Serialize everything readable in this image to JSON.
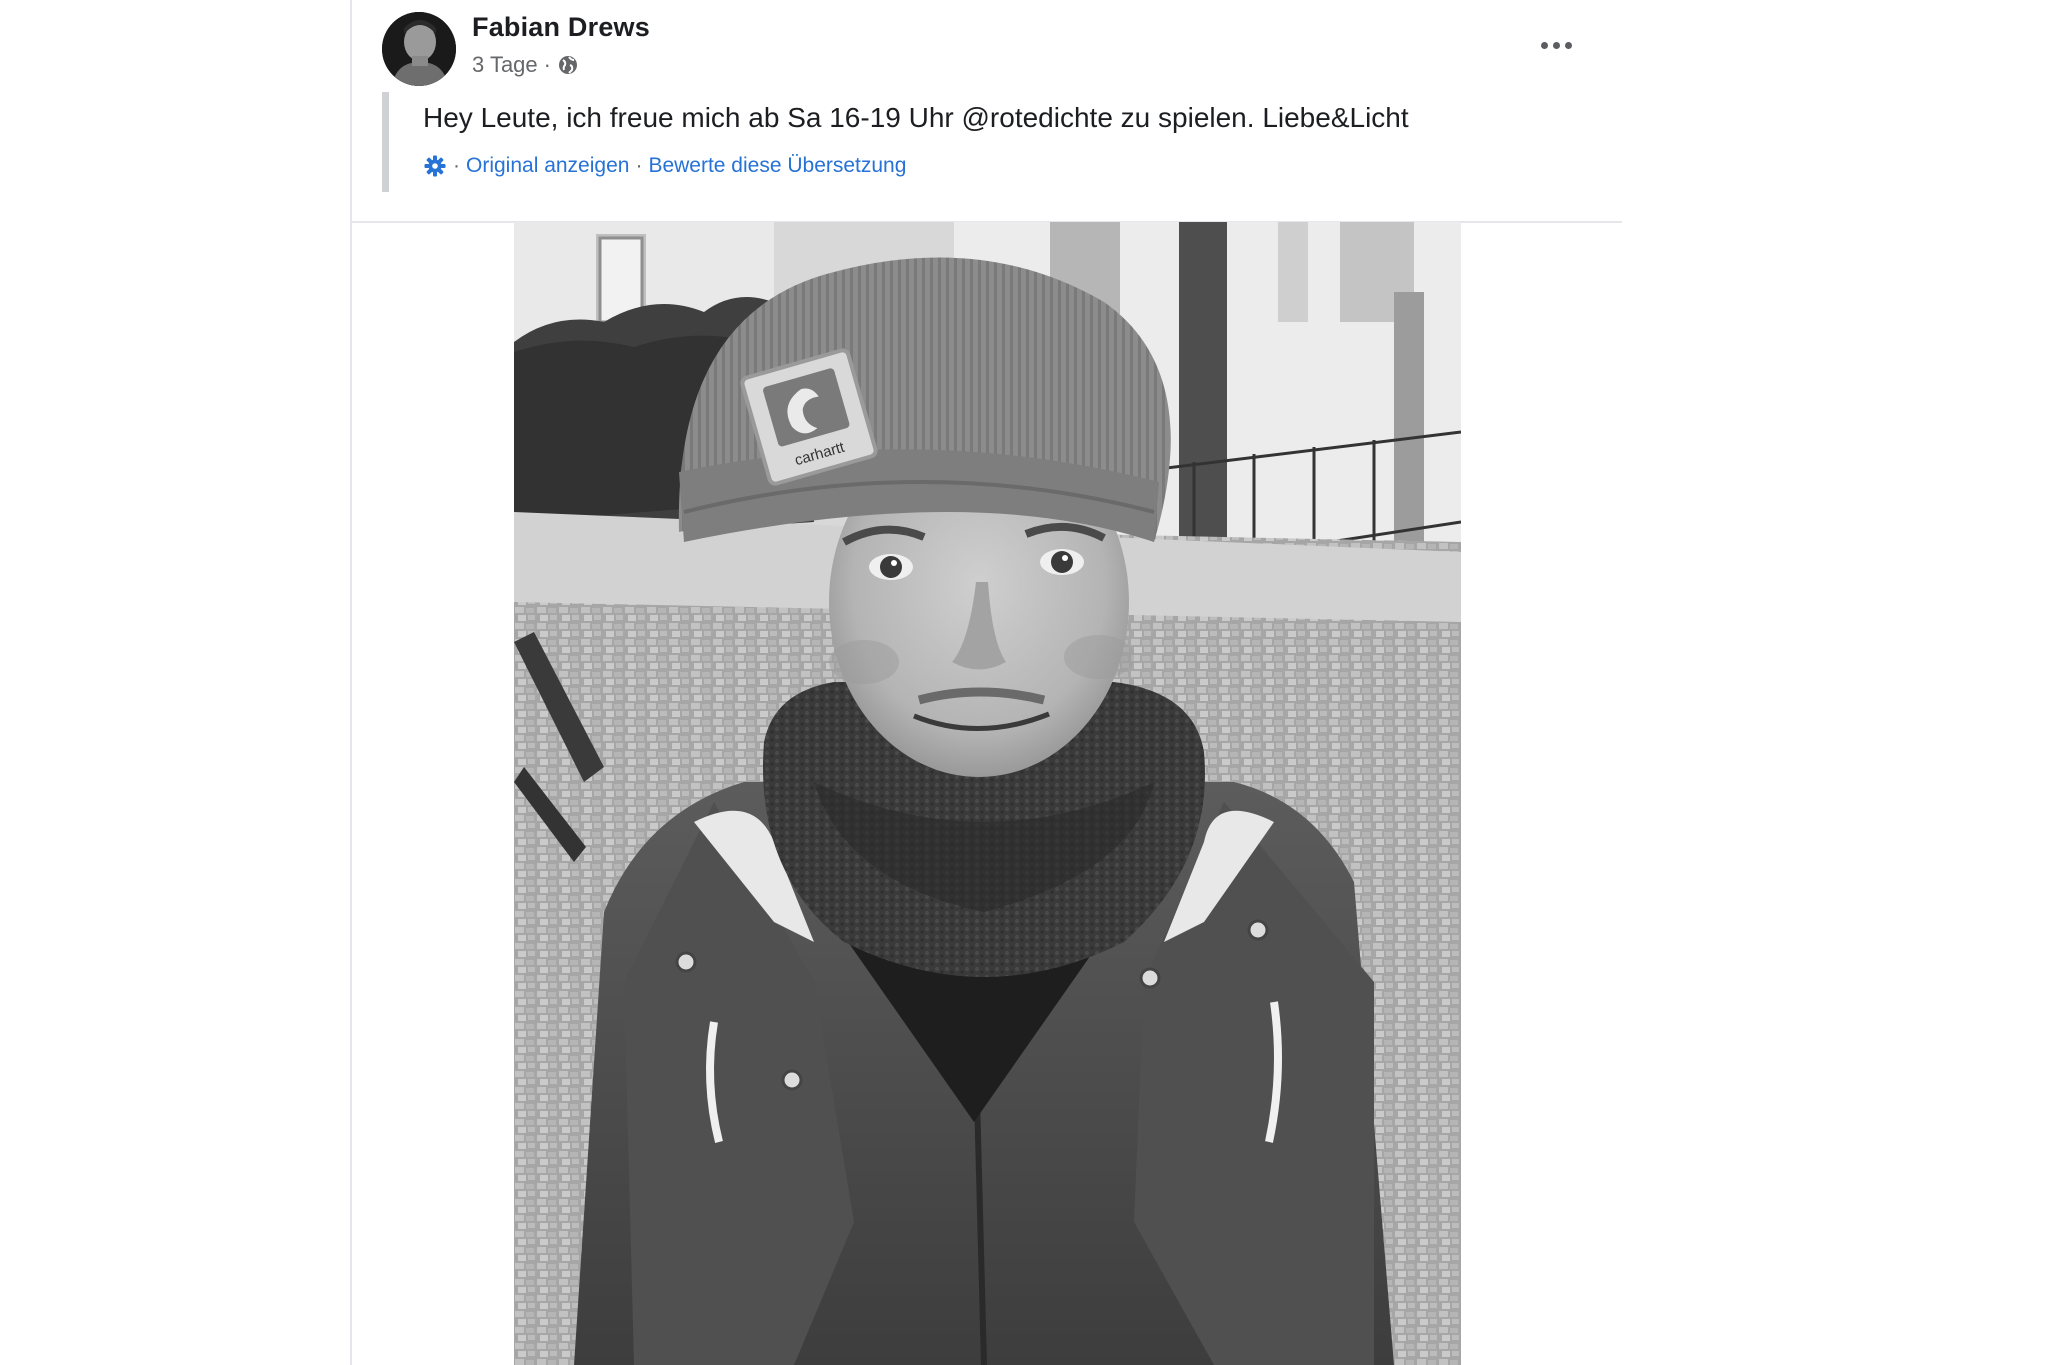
{
  "post": {
    "author": "Fabian Drews",
    "time": "3 Tage",
    "time_separator": "·",
    "audience_icon": "globe-icon",
    "menu_icon": "more-horizontal-icon",
    "text": "Hey Leute, ich freue mich ab Sa 16-19 Uhr @rotedichte zu spielen. Liebe&Licht",
    "translation": {
      "icon": "gear-icon",
      "show_original": "Original anzeigen",
      "rate_translation": "Bewerte diese Übersetzung",
      "separator": "·"
    },
    "image": {
      "description_icon": "photo",
      "badge_text": "carhartt"
    }
  },
  "colors": {
    "link": "#2672d6",
    "secondary_text": "#65676b",
    "primary_text": "#1c1e21",
    "quote_bar": "#cfd1d5"
  }
}
